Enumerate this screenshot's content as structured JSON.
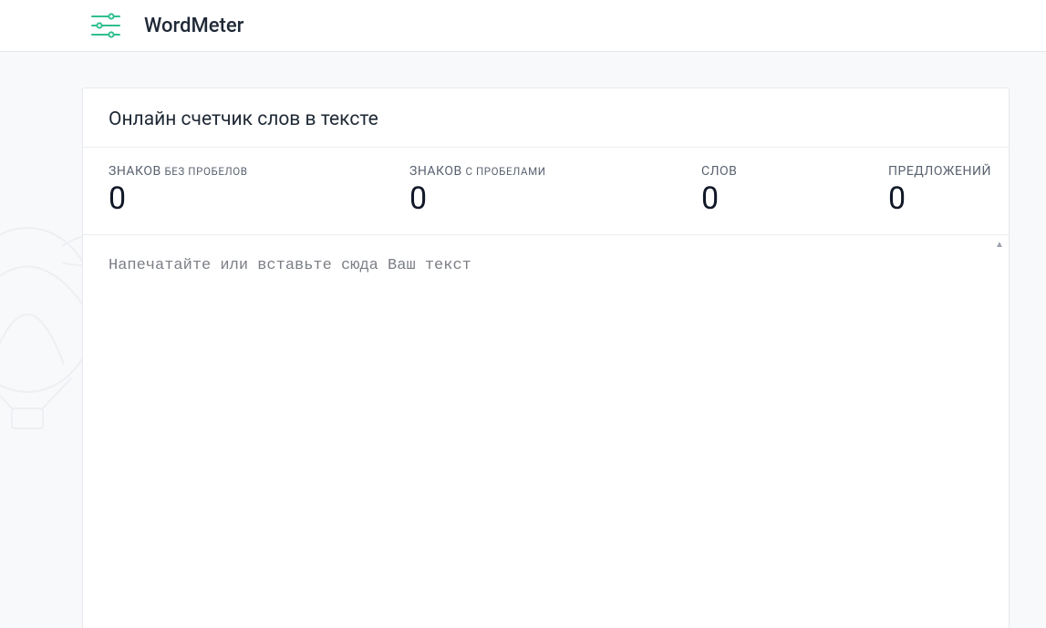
{
  "header": {
    "brand": "WordMeter"
  },
  "page": {
    "title": "Онлайн счетчик слов в тексте"
  },
  "stats": {
    "chars_no_spaces": {
      "label_main": "ЗНАКОВ",
      "label_sub": "БЕЗ ПРОБЕЛОВ",
      "value": "0"
    },
    "chars_with_spaces": {
      "label_main": "ЗНАКОВ",
      "label_sub": "С ПРОБЕЛАМИ",
      "value": "0"
    },
    "words": {
      "label_main": "СЛОВ",
      "label_sub": "",
      "value": "0"
    },
    "sentences": {
      "label_main": "ПРЕДЛОЖЕНИЙ",
      "label_sub": "",
      "value": "0"
    }
  },
  "editor": {
    "placeholder": "Напечатайте или вставьте сюда Ваш текст",
    "value": ""
  }
}
